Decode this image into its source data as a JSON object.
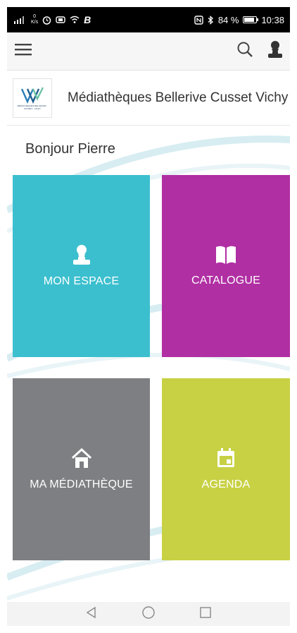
{
  "status_bar": {
    "net_speed_value": "0",
    "net_speed_unit": "K/s",
    "battery_percent_text": "84 %",
    "battery_level": 0.84,
    "time": "10:38",
    "left_icons": [
      "signal-icon",
      "alarm-icon",
      "data-saver-icon",
      "wifi-icon",
      "b-app-icon"
    ],
    "right_icons": [
      "nfc-icon",
      "bluetooth-icon",
      "battery-icon"
    ]
  },
  "toolbar": {
    "menu_icon": "menu-icon",
    "search_icon": "search-icon",
    "account_icon": "user-icon"
  },
  "library": {
    "name": "Médiathèques Bellerive Cusset Vichy",
    "logo_text": "MÉDIATHÈQUES BELLERIVE · CUSSET · VICHY"
  },
  "greeting": "Bonjour Pierre",
  "tiles": [
    {
      "label": "MON ESPACE",
      "icon": "user-icon",
      "color": "#3bbfce"
    },
    {
      "label": "CATALOGUE",
      "icon": "book-icon",
      "color": "#b02fa3"
    },
    {
      "label": "MA MÉDIATHÈQUE",
      "icon": "home-icon",
      "color": "#7d7f82"
    },
    {
      "label": "AGENDA",
      "icon": "calendar-icon",
      "color": "#c8d144"
    }
  ],
  "navbar": {
    "back_icon": "back-icon",
    "home_icon": "home-nav-icon",
    "recents_icon": "recents-icon"
  },
  "colors": {
    "accent": "#3bbfce",
    "swoosh": "#cfe9ef"
  }
}
